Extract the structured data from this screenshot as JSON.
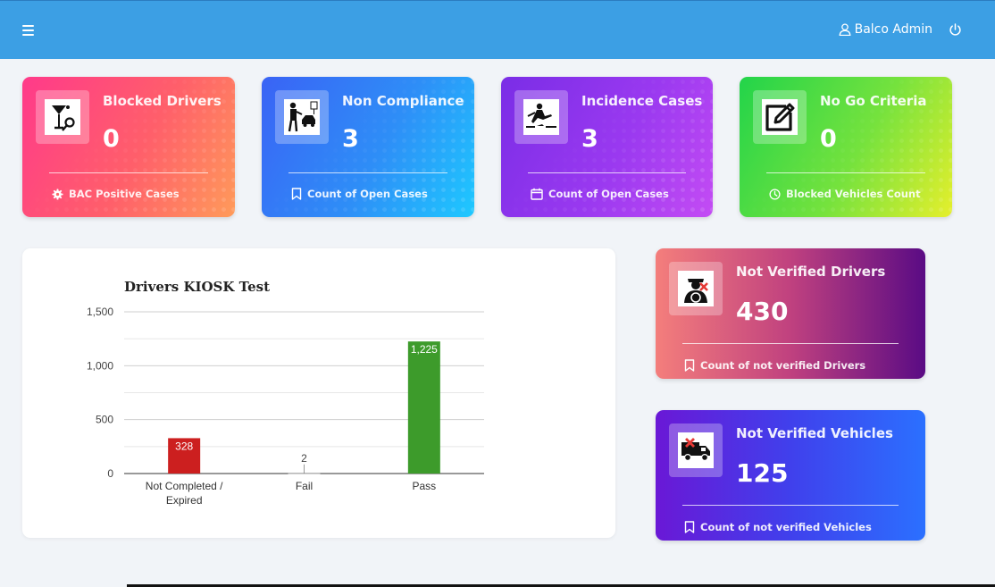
{
  "header": {
    "user_label": "Balco Admin",
    "icons": {
      "menu": "hamburger-icon",
      "user": "user-icon",
      "power": "power-icon"
    },
    "color": "#3c9fe4"
  },
  "summary_cards": [
    {
      "title": "Blocked Drivers",
      "value": "0",
      "footer": "BAC Positive Cases",
      "icon": "alcohol-icon",
      "footer_icon": "gear-icon"
    },
    {
      "title": "Non Compliance",
      "value": "3",
      "footer": "Count of Open Cases",
      "icon": "police-icon",
      "footer_icon": "bookmark-icon"
    },
    {
      "title": "Incidence Cases",
      "value": "3",
      "footer": "Count of Open Cases",
      "icon": "slip-icon",
      "footer_icon": "calendar-icon"
    },
    {
      "title": "No Go Criteria",
      "value": "0",
      "footer": "Blocked Vehicles Count",
      "icon": "edit-icon",
      "footer_icon": "clock-icon"
    }
  ],
  "side_cards": [
    {
      "title": "Not Verified Drivers",
      "value": "430",
      "footer": "Count of not verified Drivers",
      "icon": "driver-cross-icon",
      "footer_icon": "bookmark-icon"
    },
    {
      "title": "Not Verified Vehicles",
      "value": "125",
      "footer": "Count of not verified Vehicles",
      "icon": "truck-cross-icon",
      "footer_icon": "bookmark-icon"
    }
  ],
  "chart_data": {
    "type": "bar",
    "title": "Drivers KIOSK Test",
    "categories": [
      "Not Completed / Expired",
      "Fail",
      "Pass"
    ],
    "category_lines": [
      [
        "Not Completed /",
        "Expired"
      ],
      [
        "Fail"
      ],
      [
        "Pass"
      ]
    ],
    "values": [
      328,
      2,
      1225
    ],
    "value_labels": [
      "328",
      "2",
      "1,225"
    ],
    "colors": [
      "#cc1f1f",
      "#b0b0b0",
      "#3d9b2b"
    ],
    "ylim": [
      0,
      1500
    ],
    "yticks": [
      0,
      500,
      1000,
      1500
    ],
    "ytick_labels": [
      "0",
      "500",
      "1,000",
      "1,500"
    ],
    "grid": true,
    "legend": "none"
  }
}
